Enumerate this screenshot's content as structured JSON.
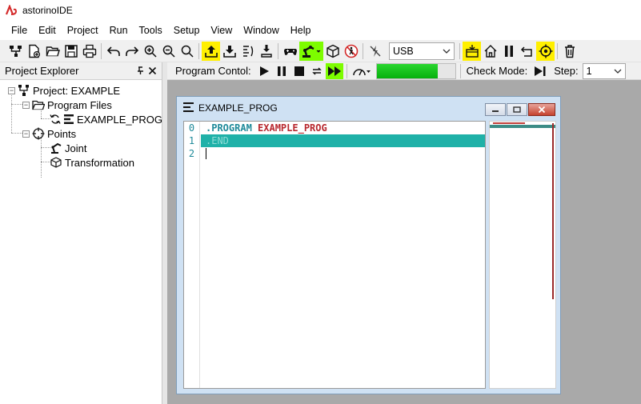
{
  "app": {
    "title": "astorinoIDE",
    "accent_color": "#d42a2a"
  },
  "menu": [
    "File",
    "Edit",
    "Project",
    "Run",
    "Tools",
    "Setup",
    "View",
    "Window",
    "Help"
  ],
  "toolbar": {
    "connection_select": {
      "value": "USB"
    },
    "icons": [
      "new-project-icon",
      "new-file-icon",
      "open-folder-icon",
      "save-icon",
      "print-icon",
      "undo-icon",
      "redo-icon",
      "zoom-in-icon",
      "zoom-out-icon",
      "search-icon",
      "upload-icon",
      "download-icon",
      "compare-icon",
      "download-robot-icon",
      "gamepad-icon",
      "robot-arm-icon",
      "cube-icon",
      "stop-person-icon",
      "no-connection-icon",
      "teach-icon",
      "home-icon",
      "pause-icon",
      "return-icon",
      "target-icon",
      "trash-icon"
    ],
    "highlight_yellow": "#ffef00",
    "highlight_green": "#7dfc00"
  },
  "explorer": {
    "title": "Project Explorer",
    "tree": {
      "project_label": "Project: EXAMPLE",
      "program_files_label": "Program Files",
      "program_label": "EXAMPLE_PROG",
      "points_label": "Points",
      "joint_label": "Joint",
      "transformation_label": "Transformation"
    }
  },
  "program_bar": {
    "program_control_label": "Program Contol:",
    "check_mode_label": "Check Mode:",
    "step_label": "Step:",
    "step_value": "1",
    "progress_fraction": 0.78
  },
  "editor_window": {
    "title": "EXAMPLE_PROG",
    "line_numbers": [
      "0",
      "1",
      "2"
    ],
    "lines": {
      "l0_keyword": ".PROGRAM",
      "l0_name": "EXAMPLE_PROG",
      "l1_keyword": ".END"
    }
  }
}
